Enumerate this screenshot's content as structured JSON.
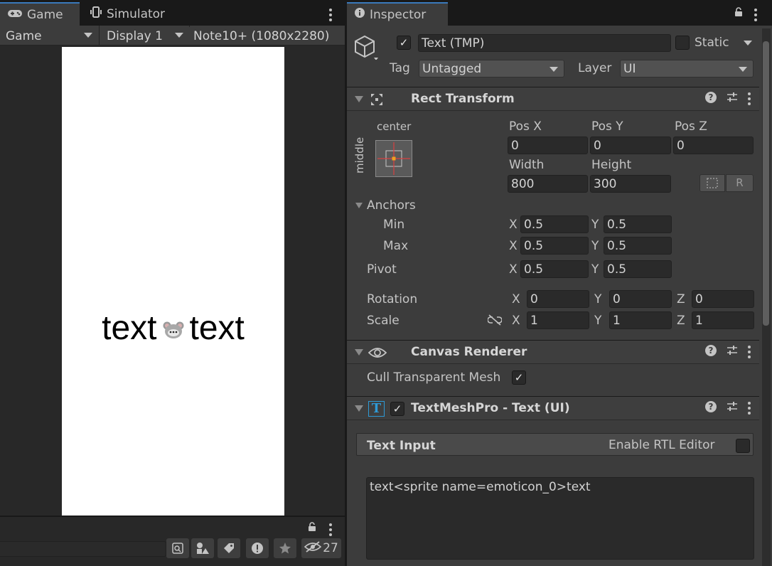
{
  "game_panel": {
    "tabs": [
      {
        "label": "Game",
        "icon": "gamepad-icon"
      },
      {
        "label": "Simulator",
        "icon": "phone-icon"
      }
    ],
    "toolbar": {
      "view_select": "Game",
      "display_select": "Display 1",
      "device_label": "Note10+ (1080x2280)"
    },
    "preview": {
      "text_left": "text",
      "sprite": "emoticon-mouse-icon",
      "text_right": "text"
    }
  },
  "bottom_left": {
    "hidden_count": "27"
  },
  "inspector": {
    "tab_label": "Inspector",
    "object": {
      "enabled": true,
      "name": "Text (TMP)",
      "static_label": "Static",
      "tag_label": "Tag",
      "tag_value": "Untagged",
      "layer_label": "Layer",
      "layer_value": "UI"
    },
    "rect_transform": {
      "title": "Rect Transform",
      "anchor_h": "center",
      "anchor_v": "middle",
      "pos_x_label": "Pos X",
      "pos_x": "0",
      "pos_y_label": "Pos Y",
      "pos_y": "0",
      "pos_z_label": "Pos Z",
      "pos_z": "0",
      "width_label": "Width",
      "width": "800",
      "height_label": "Height",
      "height": "300",
      "blueprint_label": "R",
      "anchors_label": "Anchors",
      "min_label": "Min",
      "min_x": "0.5",
      "min_y": "0.5",
      "max_label": "Max",
      "max_x": "0.5",
      "max_y": "0.5",
      "pivot_label": "Pivot",
      "pivot_x": "0.5",
      "pivot_y": "0.5",
      "rotation_label": "Rotation",
      "rot_x": "0",
      "rot_y": "0",
      "rot_z": "0",
      "scale_label": "Scale",
      "scale_x": "1",
      "scale_y": "1",
      "scale_z": "1",
      "axis_x": "X",
      "axis_y": "Y",
      "axis_z": "Z"
    },
    "canvas_renderer": {
      "title": "Canvas Renderer",
      "cull_label": "Cull Transparent Mesh",
      "cull_checked": true
    },
    "tmp": {
      "title": "TextMeshPro - Text (UI)",
      "icon_letter": "T",
      "enabled": true,
      "text_input_label": "Text Input",
      "rtl_label": "Enable RTL Editor",
      "rtl_checked": false,
      "text_value": "text<sprite name=emoticon_0>text"
    },
    "colors": {
      "accent": "#3a79bb",
      "panel": "#3c3c3c",
      "field": "#2a2a2a",
      "tmp_icon": "#2e9ad6"
    }
  }
}
